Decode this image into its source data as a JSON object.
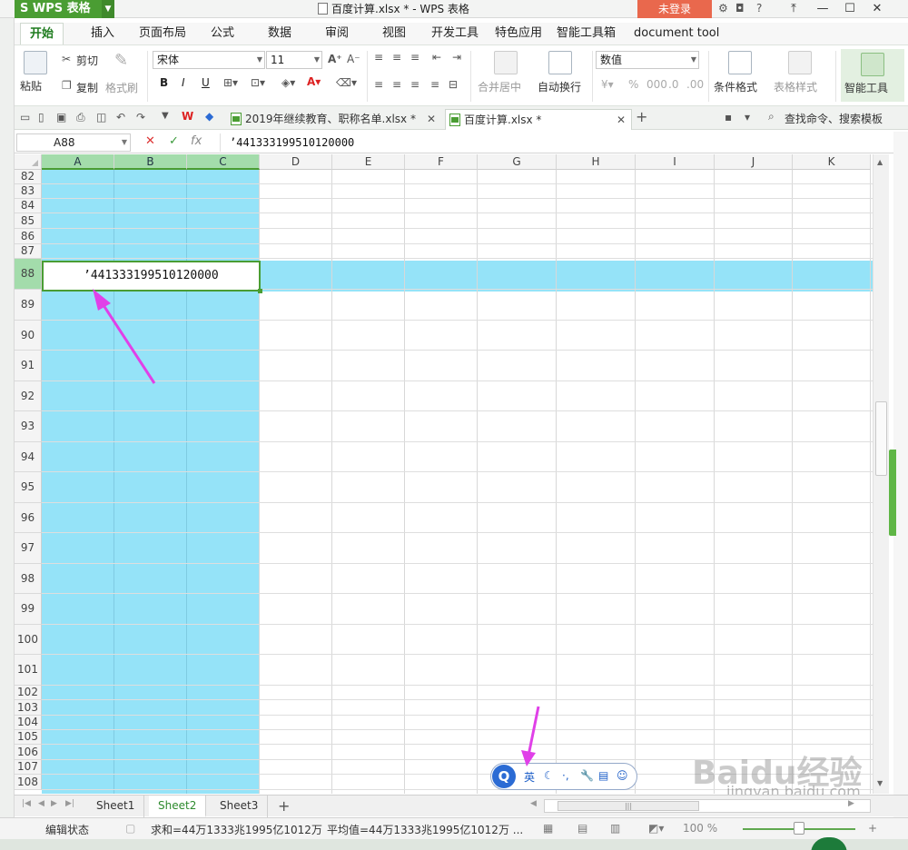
{
  "window": {
    "app_button": "WPS 表格",
    "title": "百度计算.xlsx * - WPS 表格",
    "login_button": "未登录"
  },
  "ribbon_tabs": [
    "开始",
    "插入",
    "页面布局",
    "公式",
    "数据",
    "审阅",
    "视图",
    "开发工具",
    "特色应用",
    "智能工具箱",
    "document tool"
  ],
  "ribbon": {
    "paste": "粘贴",
    "cut": "剪切",
    "copy": "复制",
    "format_painter": "格式刷",
    "font_name": "宋体",
    "font_size": "11",
    "merge_center": "合并居中",
    "wrap_text": "自动换行",
    "number_format": "数值",
    "conditional_format": "条件格式",
    "table_style": "表格样式",
    "smart_tool": "智能工具"
  },
  "doc_tabs": [
    {
      "name": "2019年继续教育、职称名单.xlsx *",
      "active": false
    },
    {
      "name": "百度计算.xlsx *",
      "active": true
    }
  ],
  "search_label": "查找命令、搜索模板",
  "formula_bar": {
    "name_box": "A88",
    "fx": "fx",
    "content": "’441333199510120000"
  },
  "columns": [
    "A",
    "B",
    "C",
    "D",
    "E",
    "F",
    "G",
    "H",
    "I",
    "J",
    "K"
  ],
  "rows": [
    "82",
    "83",
    "84",
    "85",
    "86",
    "87",
    "88",
    "89",
    "90",
    "91",
    "92",
    "93",
    "94",
    "95",
    "96",
    "97",
    "98",
    "99",
    "100",
    "101",
    "102",
    "103",
    "104",
    "105",
    "106",
    "107",
    "108"
  ],
  "active_cell": {
    "ref": "A88",
    "display": "’441333199510120000"
  },
  "ime_bar": {
    "logo": "Q",
    "lang": "英"
  },
  "sheets": [
    {
      "name": "Sheet1",
      "active": false
    },
    {
      "name": "Sheet2",
      "active": true
    },
    {
      "name": "Sheet3",
      "active": false
    }
  ],
  "status": {
    "mode": "编辑状态",
    "sum": "求和=44万1333兆1995亿1012万",
    "average": "平均值=44万1333兆1995亿1012万 ...",
    "zoom": "100 %"
  },
  "watermark": {
    "text": "Baidu经验",
    "url": "jingyan.baidu.com"
  },
  "colors": {
    "accent_green": "#4a9d33",
    "highlight_blue": "#95e3f8",
    "annotation_arrow": "#e040e8"
  }
}
